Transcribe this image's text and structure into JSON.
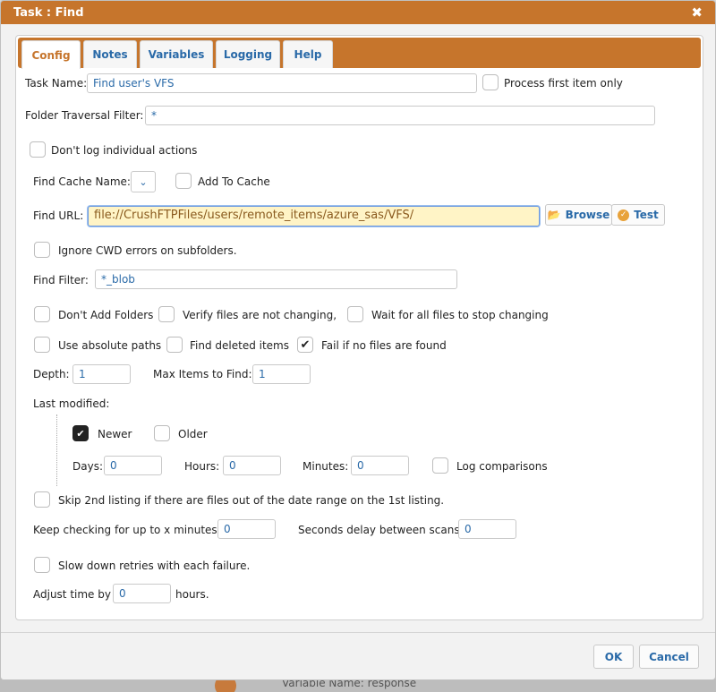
{
  "dialog": {
    "title": "Task : Find",
    "close_glyph": "✖"
  },
  "tabs": [
    {
      "label": "Config",
      "active": true
    },
    {
      "label": "Notes"
    },
    {
      "label": "Variables"
    },
    {
      "label": "Logging"
    },
    {
      "label": "Help"
    }
  ],
  "form": {
    "task_name_label": "Task Name:",
    "task_name_value": "Find user's VFS",
    "process_first_label": "Process first item only",
    "folder_traversal_label": "Folder Traversal Filter:",
    "folder_traversal_value": "*",
    "dont_log_label": "Don't log individual actions",
    "find_cache_label": "Find Cache Name:",
    "add_to_cache_label": "Add To Cache",
    "find_url_label": "Find URL:",
    "find_url_value": "file://CrushFTPFiles/users/remote_items/azure_sas/VFS/",
    "browse_label": "Browse",
    "test_label": "Test",
    "ignore_cwd_label": "Ignore CWD errors on subfolders.",
    "find_filter_label": "Find Filter:",
    "find_filter_value": "*_blob",
    "dont_add_folders_label": "Don't Add Folders",
    "verify_files_label": "Verify files are not changing,",
    "wait_all_label": "Wait for all files to stop changing",
    "absolute_paths_label": "Use absolute paths",
    "find_deleted_label": "Find deleted items",
    "fail_no_files_label": "Fail if no files are found",
    "depth_label": "Depth:",
    "depth_value": "1",
    "max_items_label": "Max Items to Find:",
    "max_items_value": "1",
    "last_modified_label": "Last modified:",
    "newer_label": "Newer",
    "older_label": "Older",
    "days_label": "Days:",
    "days_value": "0",
    "hours_label": "Hours:",
    "hours_value": "0",
    "minutes_label": "Minutes:",
    "minutes_value": "0",
    "log_comparisons_label": "Log comparisons",
    "skip_2nd_label": "Skip 2nd listing if there are files out of the date range on the 1st listing.",
    "keep_checking_label": "Keep checking for up to x minutes:",
    "keep_checking_value": "0",
    "seconds_delay_label": "Seconds delay between scans:",
    "seconds_delay_value": "0",
    "slow_down_label": "Slow down retries with each failure.",
    "adjust_time_label": "Adjust time by",
    "adjust_time_value": "0",
    "hours_suffix": "hours."
  },
  "checks": {
    "process_first": false,
    "dont_log": false,
    "add_to_cache": false,
    "ignore_cwd": false,
    "dont_add_folders": false,
    "verify_files": false,
    "wait_all": false,
    "absolute_paths": false,
    "find_deleted": false,
    "fail_no_files": true,
    "newer": true,
    "older": false,
    "log_comparisons": false,
    "skip_2nd": false,
    "slow_down": false
  },
  "footer": {
    "ok_label": "OK",
    "cancel_label": "Cancel"
  },
  "background": {
    "partial_text": "Variable Name: response"
  },
  "icons": {
    "close": "close-icon",
    "browse": "folder-icon",
    "test": "check-circle-icon",
    "dropdown": "chevron-down-icon"
  },
  "colors": {
    "accent": "#c6752c",
    "link": "#2a6aa8",
    "highlight": "#fff4c6"
  }
}
